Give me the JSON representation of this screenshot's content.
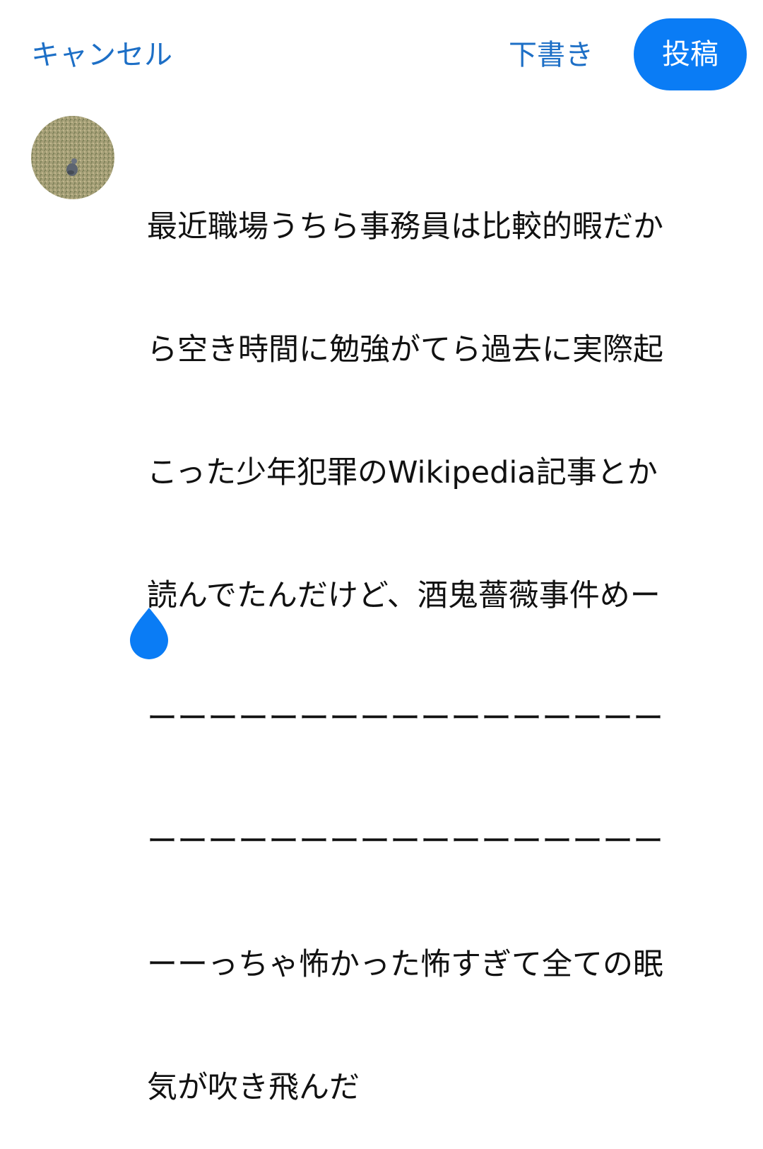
{
  "header": {
    "cancel_label": "キャンセル",
    "draft_label": "下書き",
    "post_label": "投稿"
  },
  "composer": {
    "lines": [
      "最近職場うちら事務員は比較的暇だか",
      "ら空き時間に勉強がてら過去に実際起",
      "こった少年犯罪のWikipedia記事とか",
      "読んでたんだけど、酒鬼薔薇事件めー",
      "ーーーーーーーーーーーーーーーーー",
      "ーーーーーーーーーーーーーーーーー",
      "ーーっちゃ怖かった怖すぎて全ての眠",
      "気が吹き飛んだ"
    ]
  },
  "colors": {
    "accent": "#1d6fc6",
    "post_button_bg": "#0a7cf5",
    "post_button_text": "#ffffff",
    "text": "#111111",
    "cursor_handle": "#0a7cf5"
  },
  "icons": {
    "avatar": "avatar-photo-bird-on-grass",
    "cursor": "text-cursor-handle-icon"
  }
}
